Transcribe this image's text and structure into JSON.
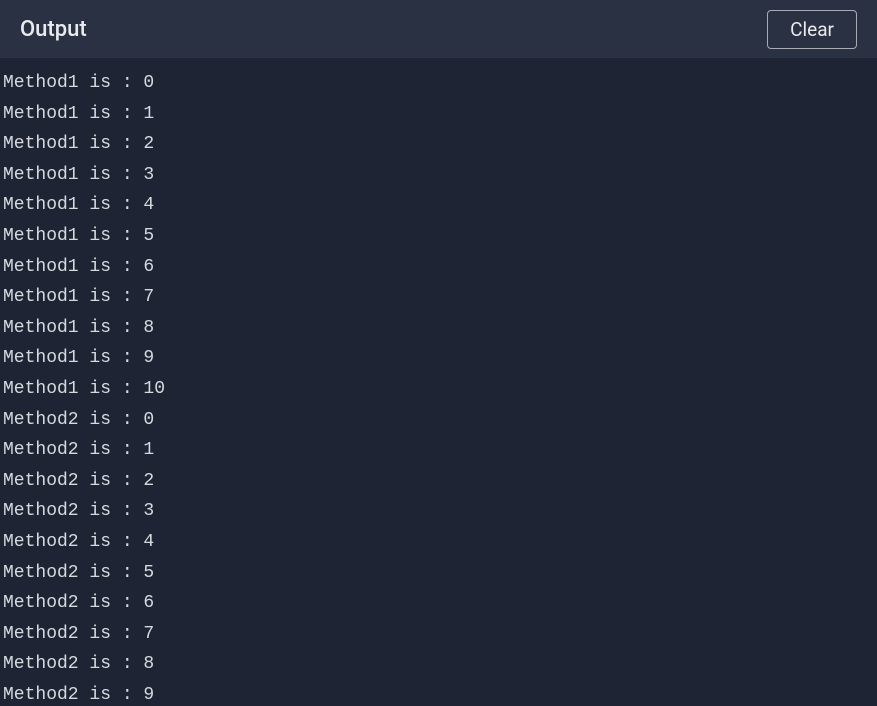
{
  "header": {
    "title": "Output",
    "clear_button_label": "Clear"
  },
  "output": {
    "lines": [
      "Method1 is : 0",
      "Method1 is : 1",
      "Method1 is : 2",
      "Method1 is : 3",
      "Method1 is : 4",
      "Method1 is : 5",
      "Method1 is : 6",
      "Method1 is : 7",
      "Method1 is : 8",
      "Method1 is : 9",
      "Method1 is : 10",
      "Method2 is : 0",
      "Method2 is : 1",
      "Method2 is : 2",
      "Method2 is : 3",
      "Method2 is : 4",
      "Method2 is : 5",
      "Method2 is : 6",
      "Method2 is : 7",
      "Method2 is : 8",
      "Method2 is : 9"
    ]
  }
}
